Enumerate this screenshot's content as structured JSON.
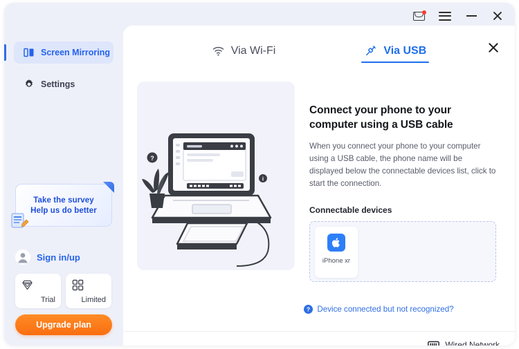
{
  "window": {
    "controls": [
      {
        "name": "mail-icon",
        "label": "Messages",
        "badge": true
      },
      {
        "name": "menu-icon",
        "label": "Menu"
      },
      {
        "name": "minimize-icon",
        "label": "Minimize"
      },
      {
        "name": "close-icon",
        "label": "Close"
      }
    ]
  },
  "sidebar": {
    "items": [
      {
        "label": "Screen Mirroring",
        "icon": "screen-mirroring-icon",
        "active": true
      },
      {
        "label": "Settings",
        "icon": "gear-icon",
        "active": false
      }
    ],
    "survey": {
      "line1": "Take the survey",
      "line2": "Help us do better",
      "icon": "survey-form-icon"
    },
    "sign_in": {
      "label": "Sign in/up",
      "icon": "avatar-icon"
    },
    "plans": [
      {
        "label": "Trial",
        "icon": "diamond-icon"
      },
      {
        "label": "Limited",
        "icon": "grid-icon"
      }
    ],
    "upgrade_label": "Upgrade plan"
  },
  "panel": {
    "close_label": "Close",
    "tabs": [
      {
        "label": "Via Wi-Fi",
        "icon": "wifi-icon",
        "active": false
      },
      {
        "label": "Via USB",
        "icon": "usb-cable-icon",
        "active": true
      }
    ],
    "illustration": "laptop-with-plant-illustration",
    "heading": "Connect your phone to your computer using a USB cable",
    "body": "When you connect your phone to your computer using a USB cable, the phone name will be displayed below the connectable devices list, click to start the connection.",
    "devices_title": "Connectable devices",
    "devices": [
      {
        "name": "iPhone xr",
        "icon": "apple-logo-icon"
      }
    ],
    "help_link": "Device connected but not recognized?",
    "help_icon": "question-circle-icon",
    "network_status": "Wired Network",
    "network_icon": "ethernet-port-icon"
  },
  "colors": {
    "accent_blue": "#2563eb",
    "tab_active": "#1f6feb",
    "upgrade_orange": "#fa6e10",
    "apple_tile": "#2d7ff9",
    "sidebar_bg": "#eef0f9"
  }
}
